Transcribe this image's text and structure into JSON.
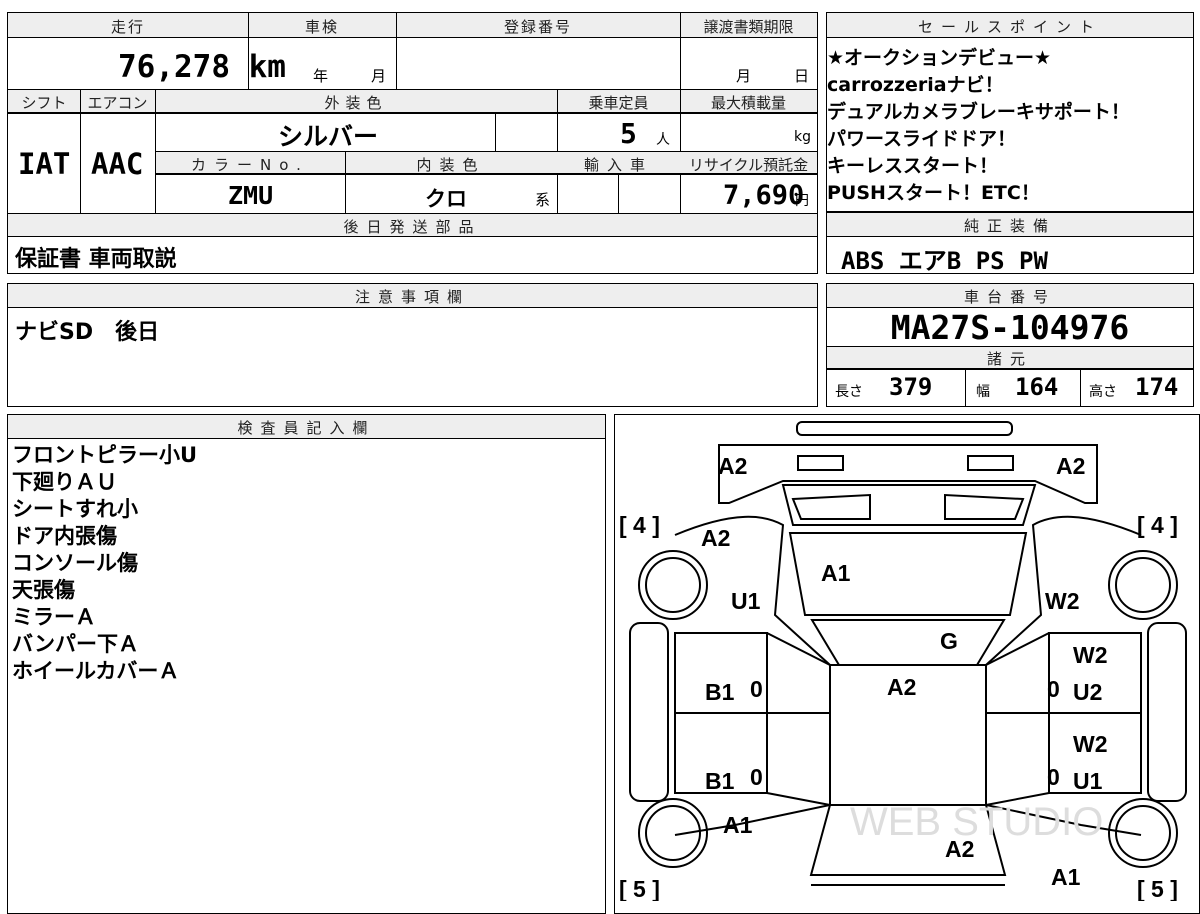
{
  "basic": {
    "mileage_label": "走行",
    "mileage": "76,278 km",
    "inspection_label": "車検",
    "inspection_year": "年",
    "inspection_month": "月",
    "registration_label": "登録番号",
    "transfer_label": "譲渡書類期限",
    "transfer_month": "月",
    "transfer_day": "日",
    "shift_label": "シフト",
    "shift": "IAT",
    "ac_label": "エアコン",
    "ac": "AAC",
    "exterior_label": "外装色",
    "exterior": "シルバー",
    "capacity_label": "乗車定員",
    "capacity": "5",
    "capacity_unit": "人",
    "maxload_label": "最大積載量",
    "maxload_unit": "kg",
    "color_no_label": "カラーNo.",
    "color_no": "ZMU",
    "interior_label": "内装色",
    "interior": "クロ",
    "interior_suffix": "系",
    "import_label": "輸入車",
    "recycle_label": "リサイクル預託金",
    "recycle": "7,690",
    "recycle_unit": "円"
  },
  "later_parts": {
    "label": "後日発送部品",
    "value": "保証書 車両取説"
  },
  "notes": {
    "label": "注意事項欄",
    "value": "ナビSD　後日"
  },
  "sales_points": {
    "label": "セールスポイント",
    "lines": [
      "★オークションデビュー★",
      "carrozzeriaナビ！",
      "デュアルカメラブレーキサポート！",
      "パワースライドドア！",
      "キーレススタート！",
      "PUSHスタート！ETC！"
    ]
  },
  "equipment": {
    "label": "純正装備",
    "value": "ABS エアB PS PW"
  },
  "chassis": {
    "label": "車台番号",
    "value": "MA27S-104976"
  },
  "specs": {
    "label": "諸元",
    "length_label": "長さ",
    "length": "379",
    "width_label": "幅",
    "width": "164",
    "height_label": "高さ",
    "height": "174"
  },
  "inspector": {
    "label": "検査員記入欄",
    "lines": [
      "フロントピラー小U",
      "下廻りＡＵ",
      "シートすれ小",
      "ドア内張傷",
      "コンソール傷",
      "天張傷",
      "ミラーＡ",
      "バンパー下Ａ",
      "ホイールカバーＡ"
    ]
  },
  "diagram": {
    "tires": [
      "[ 4 ]",
      "[ 4 ]",
      "[ 5 ]",
      "[ 5 ]"
    ],
    "marks": [
      "A2",
      "A2",
      "A2",
      "A1",
      "U1",
      "W2",
      "G",
      "W2",
      "A2",
      "B1",
      "U2",
      "W2",
      "B1",
      "U1",
      "A1",
      "A2",
      "A1"
    ],
    "zeros": [
      "0",
      "0",
      "0",
      "0"
    ]
  }
}
